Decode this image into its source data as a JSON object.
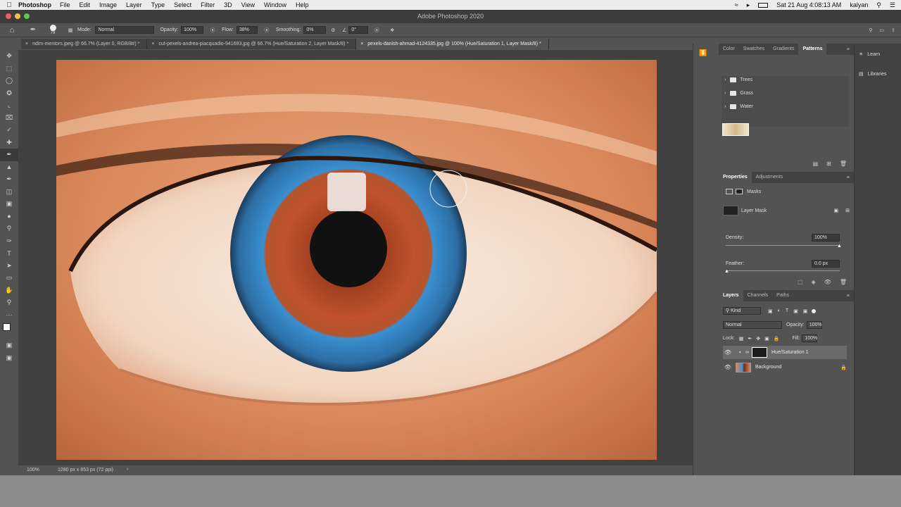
{
  "menubar": {
    "app_name": "Photoshop",
    "items": [
      "File",
      "Edit",
      "Image",
      "Layer",
      "Type",
      "Select",
      "Filter",
      "3D",
      "View",
      "Window",
      "Help"
    ],
    "datetime": "Sat 21 Aug  4:08:13 AM",
    "user": "kalyan"
  },
  "window": {
    "title": "Adobe Photoshop 2020"
  },
  "options": {
    "brush_size": "79",
    "mode_label": "Mode:",
    "mode_value": "Normal",
    "opacity_label": "Opacity:",
    "opacity_value": "100%",
    "flow_label": "Flow:",
    "flow_value": "38%",
    "smoothing_label": "Smoothing:",
    "smoothing_value": "0%",
    "angle_value": "0°"
  },
  "tabs": [
    {
      "label": "ndim-mentors.jpeg @ 66.7% (Layer 0, RGB/8#) *"
    },
    {
      "label": "cut-pexels-andrea-piacquadio-941693.jpg @ 66.7% (Hue/Saturation 2, Layer Mask/8) *"
    },
    {
      "label": "pexels-danish-ahmad-4124335.jpg @ 100% (Hue/Saturation 1, Layer Mask/8) *"
    }
  ],
  "status": {
    "zoom": "100%",
    "doc_info": "1280 px x 853 px (72 ppi)"
  },
  "panel_top": {
    "tabs": [
      "Color",
      "Swatches",
      "Gradients",
      "Patterns"
    ],
    "folders": [
      "Trees",
      "Grass",
      "Water"
    ]
  },
  "properties": {
    "tabs": [
      "Properties",
      "Adjustments"
    ],
    "masks_label": "Masks",
    "layer_mask_label": "Layer Mask",
    "density_label": "Density:",
    "density_value": "100%",
    "feather_label": "Feather:",
    "feather_value": "0.0 px"
  },
  "layers": {
    "tabs": [
      "Layers",
      "Channels",
      "Paths"
    ],
    "kind_label": "Kind",
    "blend_mode": "Normal",
    "opacity_label": "Opacity:",
    "opacity_value": "100%",
    "lock_label": "Lock:",
    "fill_label": "Fill:",
    "fill_value": "100%",
    "items": [
      {
        "name": "Hue/Saturation 1"
      },
      {
        "name": "Background"
      }
    ]
  },
  "learn_panel": {
    "items": [
      "Learn",
      "Libraries"
    ]
  },
  "colors": {
    "accent_blue": "#3a8fd0",
    "menubar_bg": "#ececec",
    "panel_bg": "#535353"
  }
}
